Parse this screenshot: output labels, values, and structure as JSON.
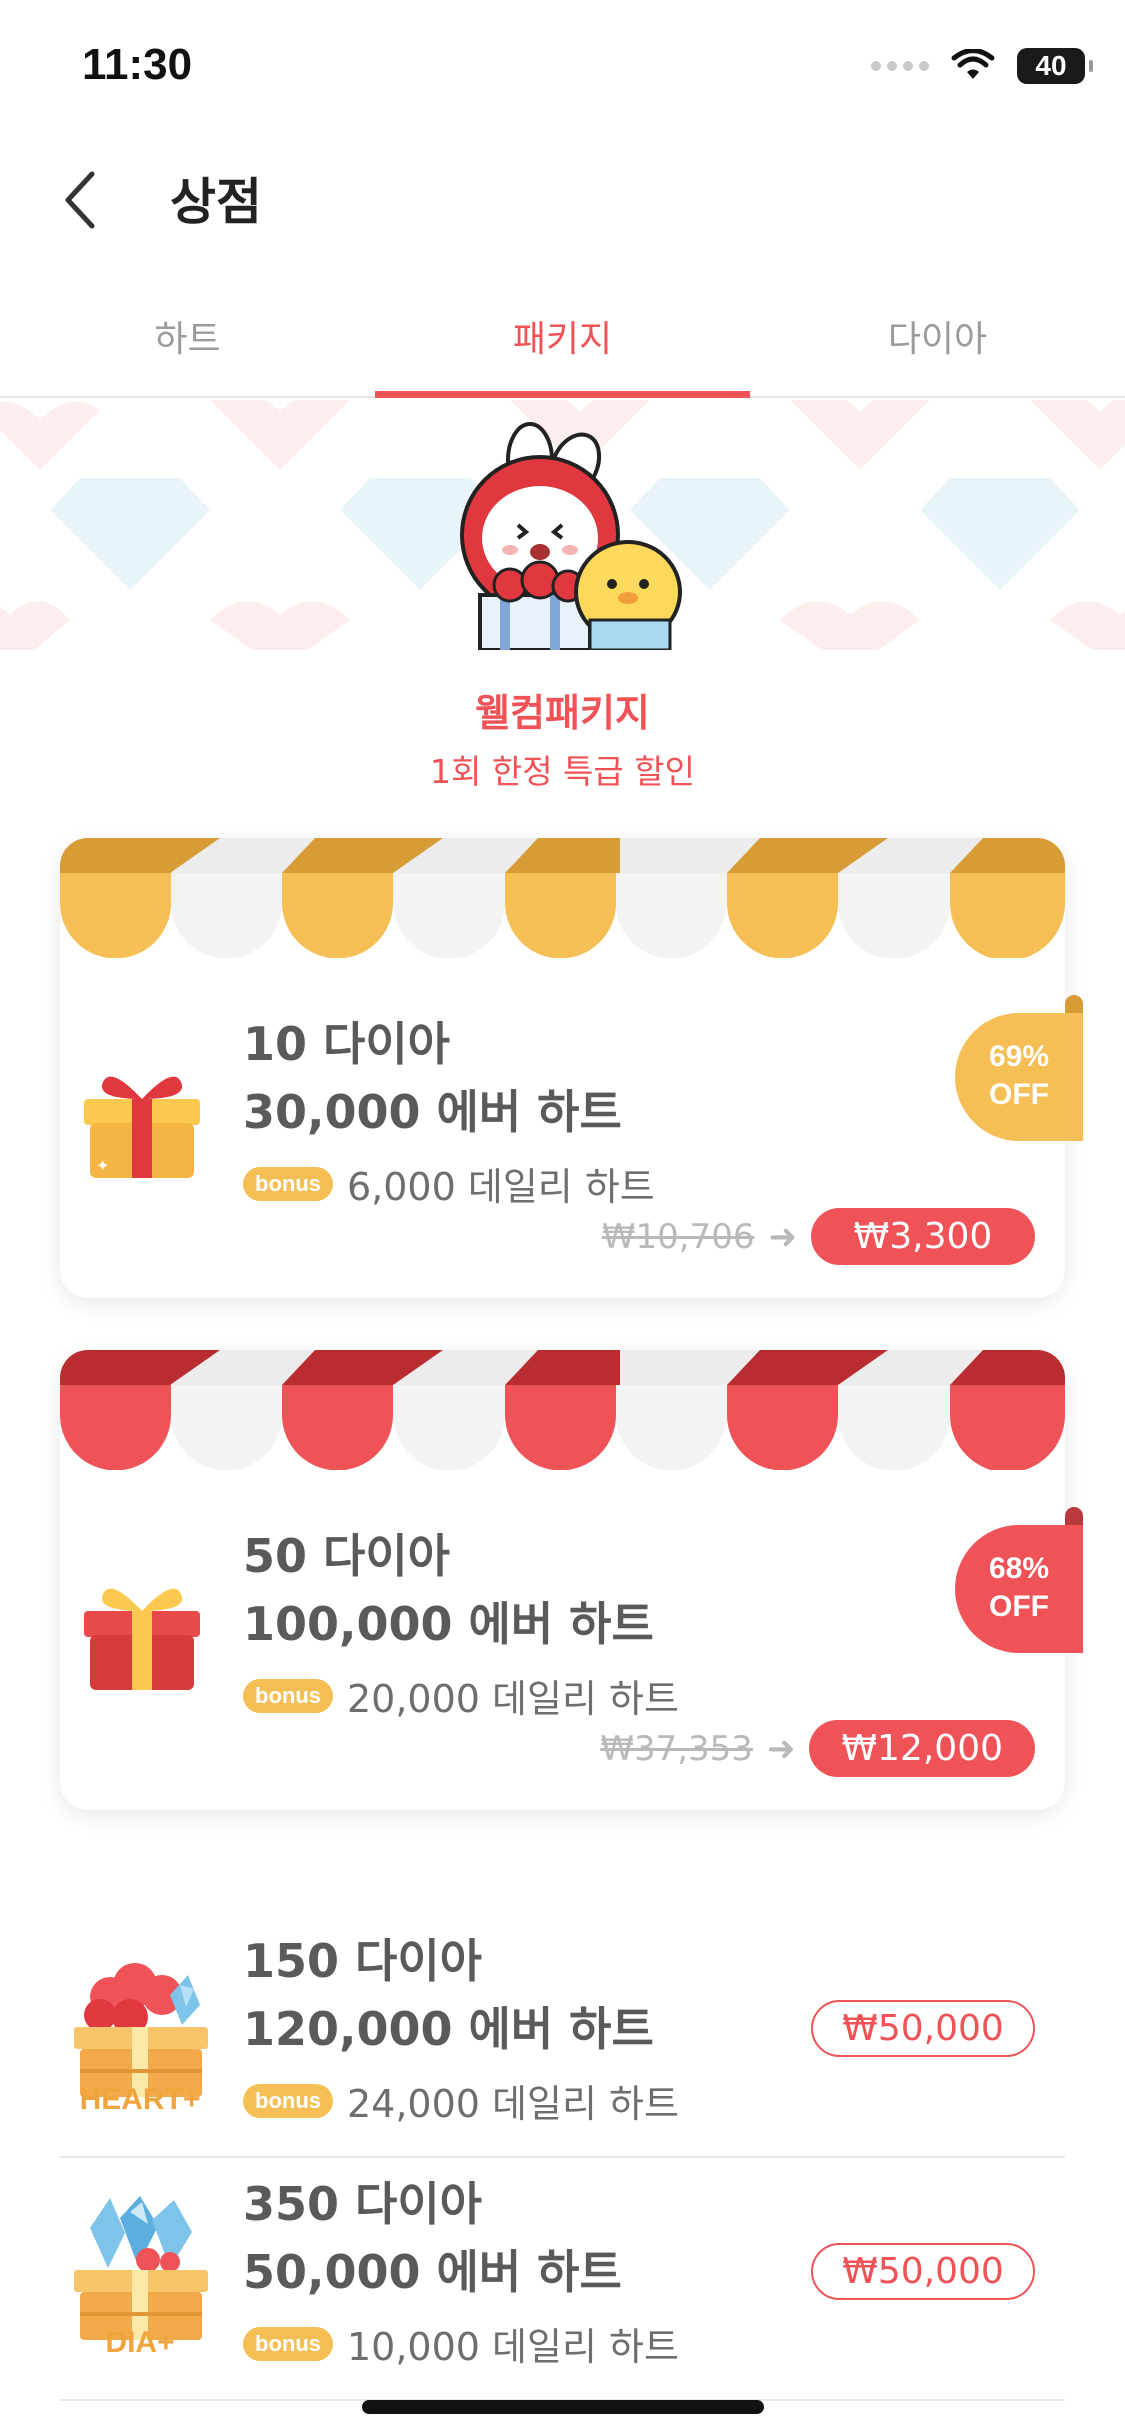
{
  "status_bar": {
    "time": "11:30",
    "battery": "40"
  },
  "nav": {
    "title": "상점"
  },
  "tabs": [
    {
      "label": "하트",
      "active": false
    },
    {
      "label": "패키지",
      "active": true
    },
    {
      "label": "다이아",
      "active": false
    }
  ],
  "welcome": {
    "title": "웰컴패키지",
    "subtitle": "1회 한정 특급 할인"
  },
  "packages": [
    {
      "line1": "10 다이아",
      "line2": "30,000 에버 하트",
      "bonus_label": "bonus",
      "bonus_text": "6,000 데일리 하트",
      "old_price": "₩10,706",
      "price": "₩3,300",
      "discount": "69%",
      "discount_off": "OFF",
      "theme": "#f5bf55"
    },
    {
      "line1": "50 다이아",
      "line2": "100,000 에버 하트",
      "bonus_label": "bonus",
      "bonus_text": "20,000 데일리 하트",
      "old_price": "₩37,353",
      "price": "₩12,000",
      "discount": "68%",
      "discount_off": "OFF",
      "theme": "#ef5257"
    }
  ],
  "list_packages": [
    {
      "icon_label": "HEART+",
      "line1": "150 다이아",
      "line2": "120,000 에버 하트",
      "bonus_label": "bonus",
      "bonus_text": "24,000 데일리 하트",
      "price": "₩50,000"
    },
    {
      "icon_label": "DIA+",
      "line1": "350 다이아",
      "line2": "50,000 에버 하트",
      "bonus_label": "bonus",
      "bonus_text": "10,000 데일리 하트",
      "price": "₩50,000"
    }
  ],
  "colors": {
    "accent": "#ef5257",
    "yellow": "#f5bf55",
    "text": "#5a5a5a"
  }
}
